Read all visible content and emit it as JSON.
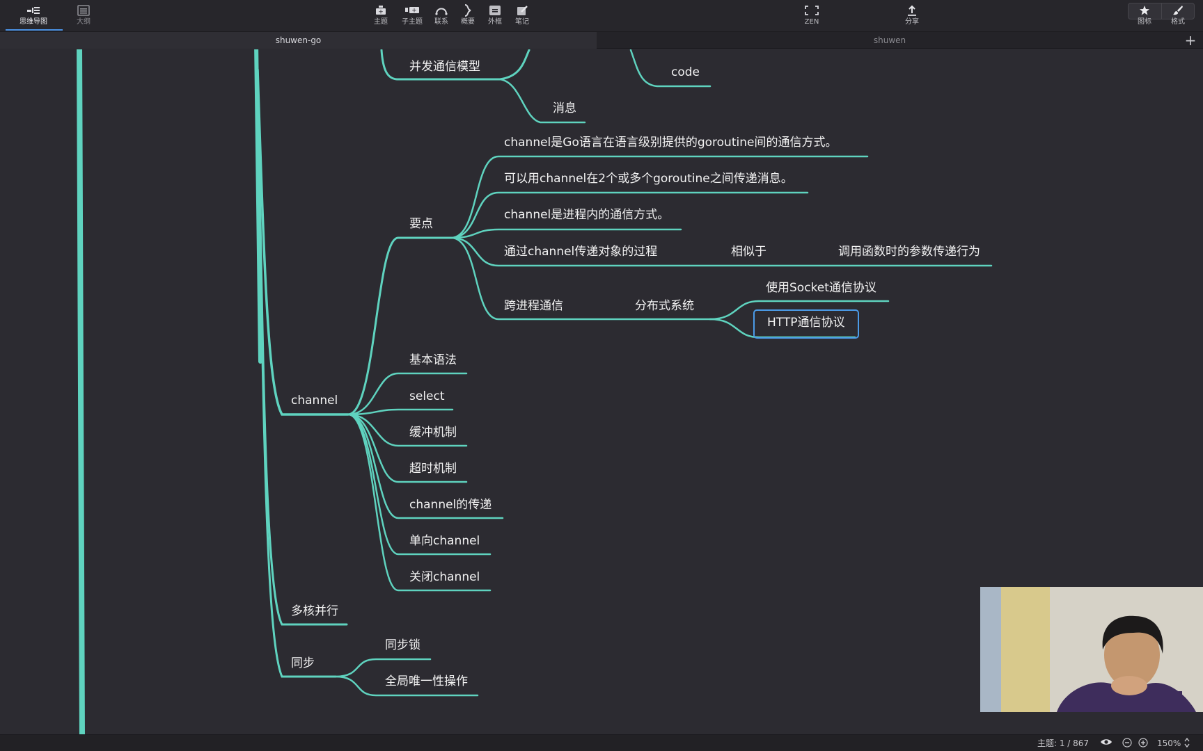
{
  "toolbar": {
    "views": [
      {
        "label": "思维导图",
        "icon": "mindmap-icon"
      },
      {
        "label": "大纲",
        "icon": "outline-icon"
      }
    ],
    "tools": [
      {
        "label": "主题",
        "icon": "topic-icon"
      },
      {
        "label": "子主题",
        "icon": "subtopic-icon"
      },
      {
        "label": "联系",
        "icon": "relationship-icon"
      },
      {
        "label": "概要",
        "icon": "summary-icon"
      },
      {
        "label": "外框",
        "icon": "boundary-icon"
      },
      {
        "label": "笔记",
        "icon": "notes-icon"
      }
    ],
    "zen": {
      "label": "ZEN",
      "icon": "zen-icon"
    },
    "share": {
      "label": "分享",
      "icon": "share-icon"
    },
    "right": [
      {
        "label": "图标",
        "icon": "star-icon"
      },
      {
        "label": "格式",
        "icon": "brush-icon"
      }
    ]
  },
  "tabs": [
    {
      "label": "shuwen-go",
      "active": true
    },
    {
      "label": "shuwen",
      "active": false
    }
  ],
  "tab_add": "+",
  "mindmap": {
    "n_bingfa": "并发通信模型",
    "n_code": "code",
    "n_xiaoxi": "消息",
    "n_p1": "channel是Go语言在语言级别提供的goroutine间的通信方式。",
    "n_p2": "可以用channel在2个或多个goroutine之间传递消息。",
    "n_p3": "channel是进程内的通信方式。",
    "n_p4": "通过channel传递对象的过程",
    "n_p4b": "相似于",
    "n_p4c": "调用函数时的参数传递行为",
    "n_yaodian": "要点",
    "n_kuajin": "跨进程通信",
    "n_fenbu": "分布式系统",
    "n_socket": "使用Socket通信协议",
    "n_http": "HTTP通信协议",
    "n_jiben": "基本语法",
    "n_select": "select",
    "n_huanchong": "缓冲机制",
    "n_chaoshi": "超时机制",
    "n_chdi": "channel的传递",
    "n_danxiang": "单向channel",
    "n_guanbi": "关闭channel",
    "n_channel": "channel",
    "n_duohe": "多核并行",
    "n_tongbu": "同步",
    "n_tongbusuo": "同步锁",
    "n_quanju": "全局唯一性操作",
    "line_color": "#5fd3bf",
    "selected_color": "#4b9be8"
  },
  "status": {
    "topic_count": "主题: 1 / 867",
    "zoom": "150%"
  }
}
